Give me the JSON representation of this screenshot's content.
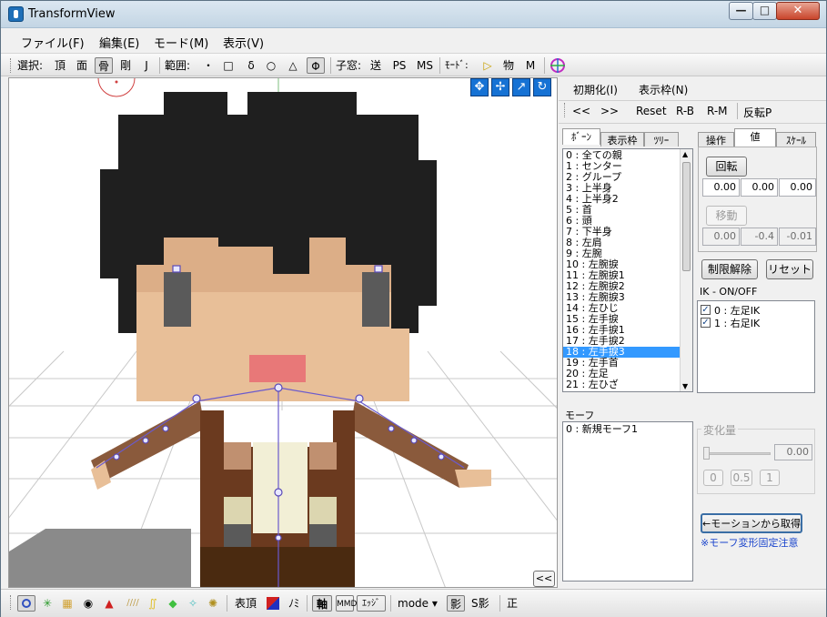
{
  "window": {
    "title": "TransformView"
  },
  "menu": [
    "ファイル(F)",
    "編集(E)",
    "モード(M)",
    "表示(V)"
  ],
  "toolbar": {
    "select_label": "選択:",
    "select_items": [
      "頂",
      "面",
      "骨",
      "剛",
      "J"
    ],
    "range_label": "範囲:",
    "range_items": [
      "・",
      "□",
      "δ",
      "○",
      "△",
      "Φ"
    ],
    "child_label": "子窓:",
    "child_items": [
      "送",
      "PS",
      "MS"
    ],
    "mode_label": "ﾓｰﾄﾞ:",
    "mode_items": [
      "▷",
      "物",
      "M"
    ]
  },
  "panel": {
    "menu": [
      "初期化(I)",
      "表示枠(N)"
    ],
    "nav": [
      "<<",
      ">>",
      "Reset",
      "R-B",
      "R-M",
      "反転P"
    ],
    "bone_tabs": [
      "ﾎﾞｰﾝ",
      "表示枠",
      "ﾂﾘｰ"
    ],
    "bones": [
      "0 : 全ての親",
      "1 : センター",
      "2 : グループ",
      "3 : 上半身",
      "4 : 上半身2",
      "5 : 首",
      "6 : 頭",
      "7 : 下半身",
      "8 : 左肩",
      "9 : 左腕",
      "10 : 左腕捩",
      "11 : 左腕捩1",
      "12 : 左腕捩2",
      "13 : 左腕捩3",
      "14 : 左ひじ",
      "15 : 左手捩",
      "16 : 左手捩1",
      "17 : 左手捩2",
      "18 : 左手捩3",
      "19 : 左手首",
      "20 : 左足",
      "21 : 左ひざ"
    ],
    "selected_bone": "18 : 左手捩3",
    "op_tabs": [
      "操作",
      "値",
      "ｽｹｰﾙ"
    ],
    "rotate_button": "回転",
    "rotate_values": [
      "0.00",
      "0.00",
      "0.00"
    ],
    "move_button": "移動",
    "move_values": [
      "0.00",
      "-0.4",
      "-0.01"
    ],
    "release_button": "制限解除",
    "reset_button": "リセット",
    "ik_title": "IK - ON/OFF",
    "ik_items": [
      "0 : 左足IK",
      "1 : 右足IK"
    ],
    "morph_title": "モーフ",
    "morphs": [
      "0 : 新規モーフ1"
    ],
    "change_title": "変化量",
    "change_value": "0.00",
    "change_buttons": [
      "0",
      "0.5",
      "1"
    ],
    "get_motion_button": "←モーションから取得",
    "morph_note": "※モーフ変形固定注意"
  },
  "viewport": {
    "collapse_button": "<<"
  },
  "status": {
    "labels": [
      "表頂",
      "ﾉﾐ",
      "軸",
      "MMD",
      "ｴｯｼﾞ",
      "mode ▾",
      "影",
      "S影",
      "正"
    ]
  },
  "colors": {
    "hair": "#1f1f1f",
    "skin": "#e8bf98",
    "mouth": "#e87878",
    "jacket": "#8a5a3c",
    "selection": "#3399ff",
    "bone_line": "#6a5acd",
    "note": "#1a44cc"
  }
}
